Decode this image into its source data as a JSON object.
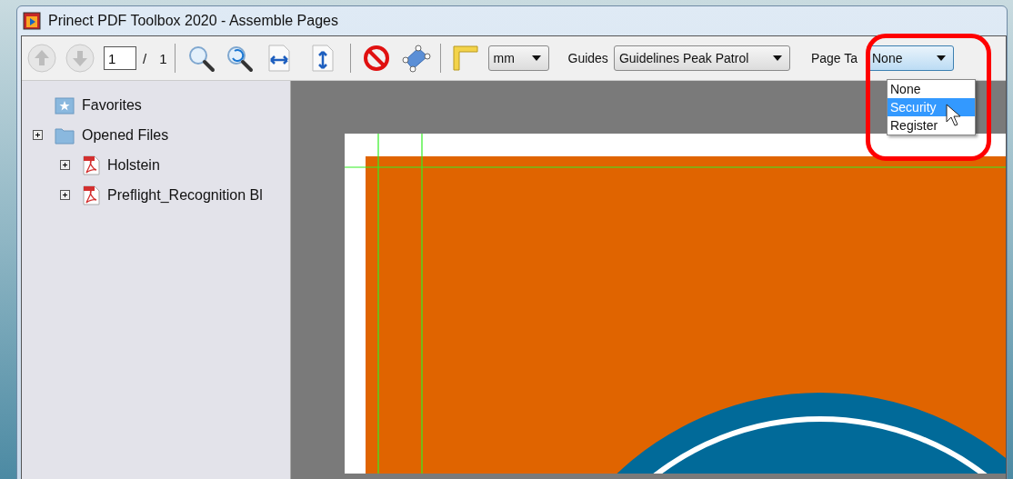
{
  "window": {
    "title": "Prinect PDF Toolbox 2020 - Assemble Pages"
  },
  "toolbar": {
    "page_number": "1",
    "page_separator": "/",
    "page_count": "1",
    "unit": "mm",
    "guides_label": "Guides",
    "guides_value": "Guidelines Peak Patrol",
    "page_tag_label": "Page Ta",
    "page_tag_value": "None"
  },
  "page_tag_options": [
    {
      "label": "None",
      "selected": false
    },
    {
      "label": "Security",
      "selected": true
    },
    {
      "label": "Register",
      "selected": false
    }
  ],
  "sidebar": {
    "items": [
      {
        "label": "Favorites",
        "kind": "favorites"
      },
      {
        "label": "Opened Files",
        "kind": "folder",
        "expanded": false,
        "children": [
          {
            "label": "Holstein",
            "kind": "pdf",
            "expanded": false
          },
          {
            "label": "Preflight_Recognition Bl",
            "kind": "pdf",
            "expanded": false
          }
        ]
      }
    ]
  }
}
